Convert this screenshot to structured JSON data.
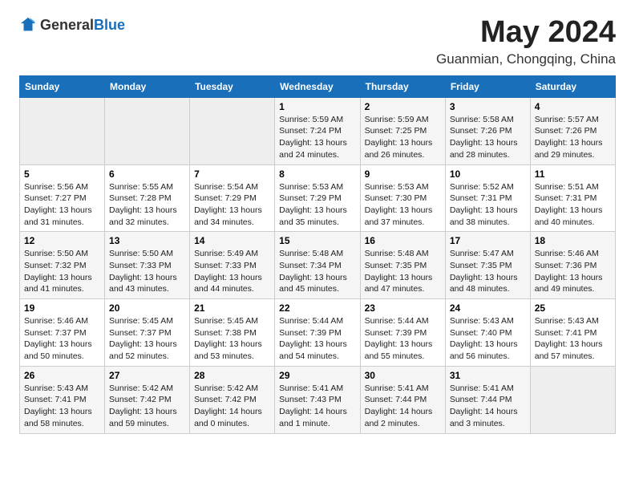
{
  "header": {
    "logo_general": "General",
    "logo_blue": "Blue",
    "month": "May 2024",
    "location": "Guanmian, Chongqing, China"
  },
  "days_of_week": [
    "Sunday",
    "Monday",
    "Tuesday",
    "Wednesday",
    "Thursday",
    "Friday",
    "Saturday"
  ],
  "weeks": [
    [
      {
        "day": "",
        "info": ""
      },
      {
        "day": "",
        "info": ""
      },
      {
        "day": "",
        "info": ""
      },
      {
        "day": "1",
        "info": "Sunrise: 5:59 AM\nSunset: 7:24 PM\nDaylight: 13 hours and 24 minutes."
      },
      {
        "day": "2",
        "info": "Sunrise: 5:59 AM\nSunset: 7:25 PM\nDaylight: 13 hours and 26 minutes."
      },
      {
        "day": "3",
        "info": "Sunrise: 5:58 AM\nSunset: 7:26 PM\nDaylight: 13 hours and 28 minutes."
      },
      {
        "day": "4",
        "info": "Sunrise: 5:57 AM\nSunset: 7:26 PM\nDaylight: 13 hours and 29 minutes."
      }
    ],
    [
      {
        "day": "5",
        "info": "Sunrise: 5:56 AM\nSunset: 7:27 PM\nDaylight: 13 hours and 31 minutes."
      },
      {
        "day": "6",
        "info": "Sunrise: 5:55 AM\nSunset: 7:28 PM\nDaylight: 13 hours and 32 minutes."
      },
      {
        "day": "7",
        "info": "Sunrise: 5:54 AM\nSunset: 7:29 PM\nDaylight: 13 hours and 34 minutes."
      },
      {
        "day": "8",
        "info": "Sunrise: 5:53 AM\nSunset: 7:29 PM\nDaylight: 13 hours and 35 minutes."
      },
      {
        "day": "9",
        "info": "Sunrise: 5:53 AM\nSunset: 7:30 PM\nDaylight: 13 hours and 37 minutes."
      },
      {
        "day": "10",
        "info": "Sunrise: 5:52 AM\nSunset: 7:31 PM\nDaylight: 13 hours and 38 minutes."
      },
      {
        "day": "11",
        "info": "Sunrise: 5:51 AM\nSunset: 7:31 PM\nDaylight: 13 hours and 40 minutes."
      }
    ],
    [
      {
        "day": "12",
        "info": "Sunrise: 5:50 AM\nSunset: 7:32 PM\nDaylight: 13 hours and 41 minutes."
      },
      {
        "day": "13",
        "info": "Sunrise: 5:50 AM\nSunset: 7:33 PM\nDaylight: 13 hours and 43 minutes."
      },
      {
        "day": "14",
        "info": "Sunrise: 5:49 AM\nSunset: 7:33 PM\nDaylight: 13 hours and 44 minutes."
      },
      {
        "day": "15",
        "info": "Sunrise: 5:48 AM\nSunset: 7:34 PM\nDaylight: 13 hours and 45 minutes."
      },
      {
        "day": "16",
        "info": "Sunrise: 5:48 AM\nSunset: 7:35 PM\nDaylight: 13 hours and 47 minutes."
      },
      {
        "day": "17",
        "info": "Sunrise: 5:47 AM\nSunset: 7:35 PM\nDaylight: 13 hours and 48 minutes."
      },
      {
        "day": "18",
        "info": "Sunrise: 5:46 AM\nSunset: 7:36 PM\nDaylight: 13 hours and 49 minutes."
      }
    ],
    [
      {
        "day": "19",
        "info": "Sunrise: 5:46 AM\nSunset: 7:37 PM\nDaylight: 13 hours and 50 minutes."
      },
      {
        "day": "20",
        "info": "Sunrise: 5:45 AM\nSunset: 7:37 PM\nDaylight: 13 hours and 52 minutes."
      },
      {
        "day": "21",
        "info": "Sunrise: 5:45 AM\nSunset: 7:38 PM\nDaylight: 13 hours and 53 minutes."
      },
      {
        "day": "22",
        "info": "Sunrise: 5:44 AM\nSunset: 7:39 PM\nDaylight: 13 hours and 54 minutes."
      },
      {
        "day": "23",
        "info": "Sunrise: 5:44 AM\nSunset: 7:39 PM\nDaylight: 13 hours and 55 minutes."
      },
      {
        "day": "24",
        "info": "Sunrise: 5:43 AM\nSunset: 7:40 PM\nDaylight: 13 hours and 56 minutes."
      },
      {
        "day": "25",
        "info": "Sunrise: 5:43 AM\nSunset: 7:41 PM\nDaylight: 13 hours and 57 minutes."
      }
    ],
    [
      {
        "day": "26",
        "info": "Sunrise: 5:43 AM\nSunset: 7:41 PM\nDaylight: 13 hours and 58 minutes."
      },
      {
        "day": "27",
        "info": "Sunrise: 5:42 AM\nSunset: 7:42 PM\nDaylight: 13 hours and 59 minutes."
      },
      {
        "day": "28",
        "info": "Sunrise: 5:42 AM\nSunset: 7:42 PM\nDaylight: 14 hours and 0 minutes."
      },
      {
        "day": "29",
        "info": "Sunrise: 5:41 AM\nSunset: 7:43 PM\nDaylight: 14 hours and 1 minute."
      },
      {
        "day": "30",
        "info": "Sunrise: 5:41 AM\nSunset: 7:44 PM\nDaylight: 14 hours and 2 minutes."
      },
      {
        "day": "31",
        "info": "Sunrise: 5:41 AM\nSunset: 7:44 PM\nDaylight: 14 hours and 3 minutes."
      },
      {
        "day": "",
        "info": ""
      }
    ]
  ]
}
